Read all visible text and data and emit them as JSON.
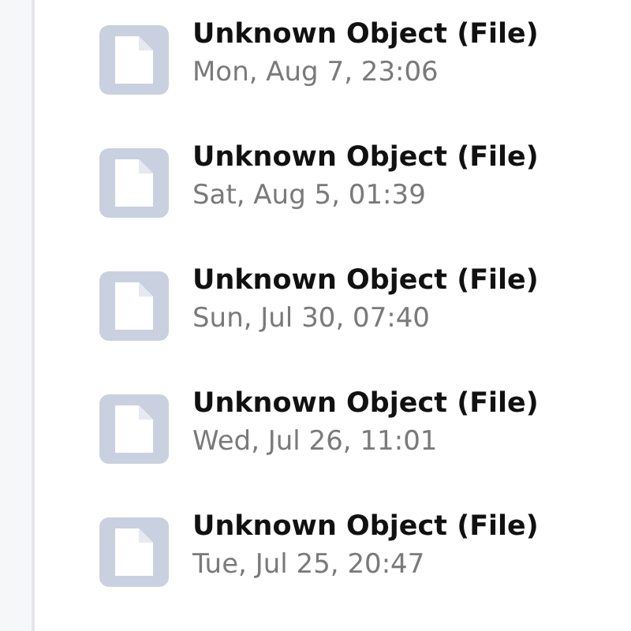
{
  "items": [
    {
      "title": "Unknown Object (File)",
      "date": "Mon, Aug 7, 23:06"
    },
    {
      "title": "Unknown Object (File)",
      "date": "Sat, Aug 5, 01:39"
    },
    {
      "title": "Unknown Object (File)",
      "date": "Sun, Jul 30, 07:40"
    },
    {
      "title": "Unknown Object (File)",
      "date": "Wed, Jul 26, 11:01"
    },
    {
      "title": "Unknown Object (File)",
      "date": "Tue, Jul 25, 20:47"
    }
  ]
}
